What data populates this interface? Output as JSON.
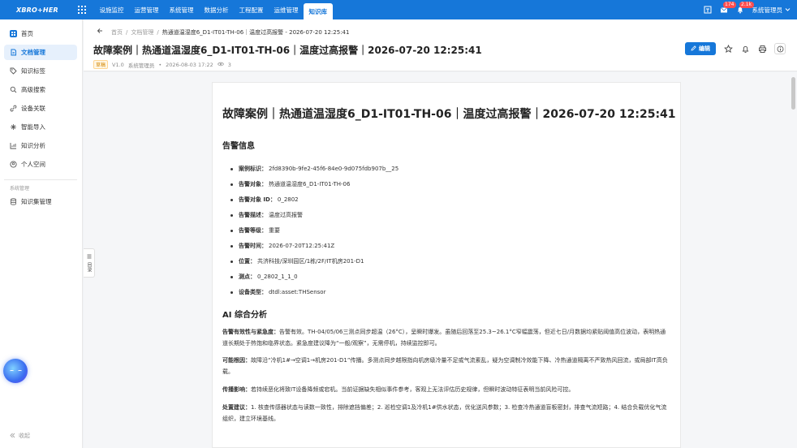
{
  "app": {
    "logo": "XBRO+HER"
  },
  "nav": {
    "items": [
      "设施监控",
      "运营管理",
      "系统管理",
      "数据分析",
      "工程配置",
      "运维管理",
      "知识库"
    ],
    "active_index": 6
  },
  "top_right": {
    "badge_mail": "174",
    "badge_bell": "2.1k",
    "user": "系统管理员"
  },
  "sidebar": {
    "items": [
      {
        "label": "首页",
        "icon": "home-icon"
      },
      {
        "label": "文档管理",
        "icon": "document-icon"
      },
      {
        "label": "知识标签",
        "icon": "tag-icon"
      },
      {
        "label": "高级搜索",
        "icon": "search-icon"
      },
      {
        "label": "设备关联",
        "icon": "link-icon"
      },
      {
        "label": "智能导入",
        "icon": "sparkle-icon"
      },
      {
        "label": "知识分析",
        "icon": "chart-icon"
      },
      {
        "label": "个人空间",
        "icon": "user-icon"
      }
    ],
    "active_index": 1,
    "group_label": "系统管理",
    "group_items": [
      {
        "label": "知识集管理",
        "icon": "database-icon"
      }
    ],
    "collapse_label": "收起"
  },
  "breadcrumb": {
    "items": [
      "首页",
      "文档管理",
      "热通道温湿度6_D1-IT01-TH-06｜温度过高报警 - 2026-07-20 12:25:41"
    ]
  },
  "doc": {
    "title": "故障案例｜热通道温湿度6_D1-IT01-TH-06｜温度过高报警｜2026-07-20 12:25:41",
    "status_tag": "草稿",
    "version": "V1.0",
    "author": "系统管理员",
    "sep": "•",
    "updated": "2026-08-03 17:22",
    "views": "3",
    "edit_label": "编辑"
  },
  "toc_label": "目录",
  "body": {
    "h1": "故障案例｜热通道温湿度6_D1-IT01-TH-06｜温度过高报警｜2026-07-20 12:25:41",
    "alarm_heading": "告警信息",
    "alarm_items": [
      {
        "k": "案例标识：",
        "v": "2fd8390b-9fe2-45f6-84e0-9d075fdb907b__25"
      },
      {
        "k": "告警对象：",
        "v": "热通道温湿度6_D1-IT01-TH-06"
      },
      {
        "k": "告警对象 ID：",
        "v": "0_2802"
      },
      {
        "k": "告警描述：",
        "v": "温度过高报警"
      },
      {
        "k": "告警等级：",
        "v": "重要"
      },
      {
        "k": "告警时间：",
        "v": "2026-07-20T12:25:41Z"
      },
      {
        "k": "位置：",
        "v": "共济科技/深圳园区/1栋/2F/IT机房201-D1"
      },
      {
        "k": "测点：",
        "v": "0_2802_1_1_0"
      },
      {
        "k": "设备类型：",
        "v": "dtdl:asset:THSensor"
      }
    ],
    "ai_heading": "AI 综合分析",
    "paragraphs": [
      {
        "k": "告警有效性与紧急度：",
        "v": "告警有效。TH-04/05/06三测点同步超温（26°C），呈瞬时爆发。虽随后回落至25.3~26.1°C窄幅震荡，但近七日/月数据均紧贴阈值高位波动，表明热通道长期处于热饱和临界状态。紧急度建议降为“一般/观察”，无需停机，持续监控即可。"
      },
      {
        "k": "可能根因：",
        "v": "故障沿“冷机1#→空调1→机房201-D1”传播。多测点同步越限指向机房级冷量不足或气流紊乱，疑为空调制冷效能下降、冷热通道隔离不严致热风回流，或局部IT高负载。"
      },
      {
        "k": "传播影响：",
        "v": "若持续恶化将致IT设备降频或宕机。当前证据缺失相似事件参考，客观上无法评估历史规律，但瞬时波动特征表明当前风险可控。"
      },
      {
        "k": "处置建议：",
        "v": "1. 核查传感器状态与读数一致性，排除遮挡偏差；2. 巡检空调1及冷机1#供水状态，优化送风参数；3. 检查冷热通道盲板密封，排查气流短路；4. 结合负载优化气流组织，建立环境基线。"
      }
    ]
  }
}
